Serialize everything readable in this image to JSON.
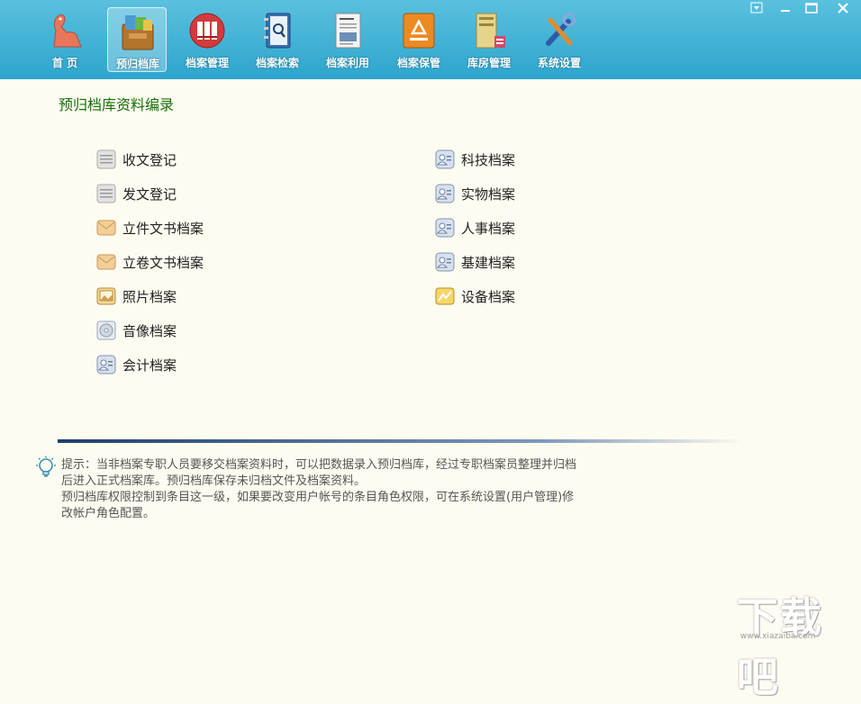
{
  "toolbar": {
    "items": [
      {
        "label": "首 页",
        "icon": "dinosaur-icon"
      },
      {
        "label": "预归档库",
        "icon": "archive-box-icon",
        "active": true
      },
      {
        "label": "档案管理",
        "icon": "binders-icon"
      },
      {
        "label": "档案检索",
        "icon": "notebook-search-icon"
      },
      {
        "label": "档案利用",
        "icon": "document-icon"
      },
      {
        "label": "档案保管",
        "icon": "recycle-box-icon"
      },
      {
        "label": "库房管理",
        "icon": "shelf-icon"
      },
      {
        "label": "系统设置",
        "icon": "tools-icon"
      }
    ]
  },
  "window_controls": [
    "dropdown-icon",
    "minimize-icon",
    "maximize-icon",
    "close-icon"
  ],
  "page_title": "预归档库资料编录",
  "left_column": [
    {
      "label": "收文登记",
      "icon": "document-grey-icon"
    },
    {
      "label": "发文登记",
      "icon": "document-grey-icon"
    },
    {
      "label": "立件文书档案",
      "icon": "envelope-icon"
    },
    {
      "label": "立卷文书档案",
      "icon": "envelope-icon"
    },
    {
      "label": "照片档案",
      "icon": "photo-icon"
    },
    {
      "label": "音像档案",
      "icon": "disc-icon"
    },
    {
      "label": "会计档案",
      "icon": "id-card-icon"
    }
  ],
  "right_column": [
    {
      "label": "科技档案",
      "icon": "id-card-icon"
    },
    {
      "label": "实物档案",
      "icon": "id-card-icon"
    },
    {
      "label": "人事档案",
      "icon": "id-card-icon"
    },
    {
      "label": "基建档案",
      "icon": "id-card-icon"
    },
    {
      "label": "设备档案",
      "icon": "equipment-icon"
    }
  ],
  "tip": {
    "lines": [
      "提示：当非档案专职人员要移交档案资料时，可以把数据录入预归档库，经过专职档案员整理并归档",
      "后进入正式档案库。预归档库保存未归档文件及档案资料。",
      "预归档库权限控制到条目这一级，如果要改变用户帐号的条目角色权限，可在系统设置(用户管理)修",
      "改帐户角色配置。"
    ]
  },
  "watermark": {
    "text": "下载吧",
    "url": "www.xiazaiba.com"
  },
  "colors": {
    "toolbar": "#2ea5cd",
    "title": "#156e08",
    "background": "#fefcf1"
  }
}
